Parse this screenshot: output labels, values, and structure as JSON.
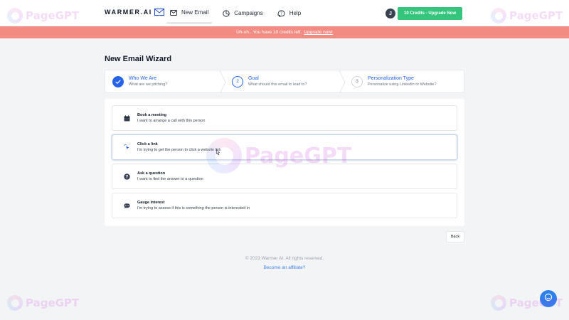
{
  "header": {
    "logo_text": "WARMER.AI",
    "nav": [
      {
        "label": "New Email",
        "icon": "envelope-icon",
        "active": true
      },
      {
        "label": "Campaigns",
        "icon": "campaign-icon",
        "active": false
      },
      {
        "label": "Help",
        "icon": "help-icon",
        "active": false
      }
    ],
    "avatar_initial": "J",
    "credits_button": "10 Credits - Upgrade Now"
  },
  "banner": {
    "message": "Uh-oh...You have 10 credits left.",
    "link": "Upgrade now!"
  },
  "page_title": "New Email Wizard",
  "steps": [
    {
      "number": "",
      "state": "done",
      "title": "Who We Are",
      "subtitle": "What are we pitching?"
    },
    {
      "number": "2",
      "state": "current",
      "title": "Goal",
      "subtitle": "What should this email to lead to?"
    },
    {
      "number": "3",
      "state": "future",
      "title": "Personalization Type",
      "subtitle": "Personalize using LinkedIn or Website?"
    }
  ],
  "options": [
    {
      "title": "Book a meeting",
      "description": "I want to arrange a call with this person",
      "icon": "calendar-icon"
    },
    {
      "title": "Click a link",
      "description": "I'm trying to get the person to click a website link",
      "icon": "cursor-click-icon"
    },
    {
      "title": "Ask a question",
      "description": "I want to find the answer to a question",
      "icon": "question-icon"
    },
    {
      "title": "Gauge interest",
      "description": "I'm trying to assess if this is something the person is interested in",
      "icon": "chat-bubble-icon"
    }
  ],
  "back_button": "Back",
  "footer": {
    "copyright": "© 2023 Warmer AI. All rights reserved.",
    "affiliate_link": "Become an affiliate?"
  },
  "watermark_text": "PageGPT",
  "colors": {
    "primary_blue": "#2563eb",
    "credits_green": "#34c47c",
    "banner_red": "#f28b82",
    "help_blue": "#2f80ed"
  }
}
